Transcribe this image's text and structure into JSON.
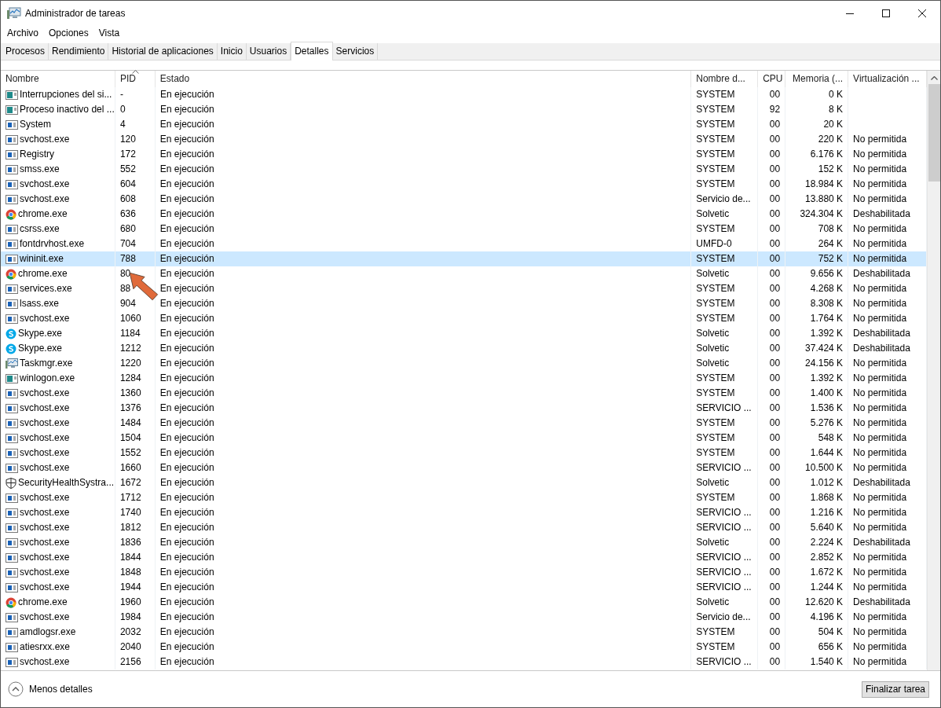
{
  "window": {
    "title": "Administrador de tareas"
  },
  "menu": [
    "Archivo",
    "Opciones",
    "Vista"
  ],
  "tabs": [
    {
      "label": "Procesos",
      "selected": false
    },
    {
      "label": "Rendimiento",
      "selected": false
    },
    {
      "label": "Historial de aplicaciones",
      "selected": false
    },
    {
      "label": "Inicio",
      "selected": false
    },
    {
      "label": "Usuarios",
      "selected": false
    },
    {
      "label": "Detalles",
      "selected": true
    },
    {
      "label": "Servicios",
      "selected": false
    }
  ],
  "table": {
    "columns": [
      {
        "label": "Nombre",
        "sorted": false
      },
      {
        "label": "PID",
        "sorted": true
      },
      {
        "label": "Estado",
        "sorted": false
      },
      {
        "label": "Nombre d...",
        "sorted": false
      },
      {
        "label": "CPU",
        "sorted": false
      },
      {
        "label": "Memoria (...",
        "sorted": false
      },
      {
        "label": "Virtualización ...",
        "sorted": false
      }
    ],
    "rows": [
      {
        "kind": "app",
        "name": "Interrupciones del si...",
        "pid": "-",
        "status": "En ejecución",
        "user": "SYSTEM",
        "cpu": "00",
        "memory": "0 K",
        "selected": false
      },
      {
        "kind": "app",
        "name": "Proceso inactivo del ...",
        "pid": "0",
        "status": "En ejecución",
        "user": "SYSTEM",
        "cpu": "92",
        "memory": "8 K",
        "selected": false
      },
      {
        "kind": "service",
        "name": "System",
        "pid": "4",
        "status": "En ejecución",
        "user": "SYSTEM",
        "cpu": "00",
        "memory": "20 K",
        "selected": false
      },
      {
        "kind": "service",
        "name": "svchost.exe",
        "pid": "120",
        "status": "En ejecución",
        "user": "SYSTEM",
        "cpu": "00",
        "memory": "220 K",
        "virtualization": "No permitida",
        "selected": false
      },
      {
        "kind": "service",
        "name": "Registry",
        "pid": "172",
        "status": "En ejecución",
        "user": "SYSTEM",
        "cpu": "00",
        "memory": "6.176 K",
        "virtualization": "No permitida",
        "selected": false
      },
      {
        "kind": "service",
        "name": "smss.exe",
        "pid": "552",
        "status": "En ejecución",
        "user": "SYSTEM",
        "cpu": "00",
        "memory": "152 K",
        "virtualization": "No permitida",
        "selected": false
      },
      {
        "kind": "service",
        "name": "svchost.exe",
        "pid": "604",
        "status": "En ejecución",
        "user": "SYSTEM",
        "cpu": "00",
        "memory": "18.984 K",
        "virtualization": "No permitida",
        "selected": false
      },
      {
        "kind": "service",
        "name": "svchost.exe",
        "pid": "608",
        "status": "En ejecución",
        "user": "Servicio de...",
        "cpu": "00",
        "memory": "13.880 K",
        "virtualization": "No permitida",
        "selected": false
      },
      {
        "kind": "chrome",
        "name": "chrome.exe",
        "pid": "636",
        "status": "En ejecución",
        "user": "Solvetic",
        "cpu": "00",
        "memory": "324.304 K",
        "virtualization": "Deshabilitada",
        "selected": false
      },
      {
        "kind": "service",
        "name": "csrss.exe",
        "pid": "680",
        "status": "En ejecución",
        "user": "SYSTEM",
        "cpu": "00",
        "memory": "708 K",
        "virtualization": "No permitida",
        "selected": false
      },
      {
        "kind": "service",
        "name": "fontdrvhost.exe",
        "pid": "704",
        "status": "En ejecución",
        "user": "UMFD-0",
        "cpu": "00",
        "memory": "264 K",
        "virtualization": "No permitida",
        "selected": false
      },
      {
        "kind": "service",
        "name": "wininit.exe",
        "pid": "788",
        "status": "En ejecución",
        "user": "SYSTEM",
        "cpu": "00",
        "memory": "752 K",
        "virtualization": "No permitida",
        "selected": true
      },
      {
        "kind": "chrome",
        "name": "chrome.exe",
        "pid": "80",
        "status": "En ejecución",
        "user": "Solvetic",
        "cpu": "00",
        "memory": "9.656 K",
        "virtualization": "Deshabilitada",
        "selected": false
      },
      {
        "kind": "service",
        "name": "services.exe",
        "pid": "88",
        "status": "En ejecución",
        "user": "SYSTEM",
        "cpu": "00",
        "memory": "4.268 K",
        "virtualization": "No permitida",
        "selected": false
      },
      {
        "kind": "service",
        "name": "lsass.exe",
        "pid": "904",
        "status": "En ejecución",
        "user": "SYSTEM",
        "cpu": "00",
        "memory": "8.308 K",
        "virtualization": "No permitida",
        "selected": false
      },
      {
        "kind": "service",
        "name": "svchost.exe",
        "pid": "1060",
        "status": "En ejecución",
        "user": "SYSTEM",
        "cpu": "00",
        "memory": "1.764 K",
        "virtualization": "No permitida",
        "selected": false
      },
      {
        "kind": "skype",
        "name": "Skype.exe",
        "pid": "1184",
        "status": "En ejecución",
        "user": "Solvetic",
        "cpu": "00",
        "memory": "1.392 K",
        "virtualization": "Deshabilitada",
        "selected": false
      },
      {
        "kind": "skype",
        "name": "Skype.exe",
        "pid": "1212",
        "status": "En ejecución",
        "user": "Solvetic",
        "cpu": "00",
        "memory": "37.424 K",
        "virtualization": "Deshabilitada",
        "selected": false
      },
      {
        "kind": "monitor",
        "name": "Taskmgr.exe",
        "pid": "1220",
        "status": "En ejecución",
        "user": "Solvetic",
        "cpu": "00",
        "memory": "24.156 K",
        "virtualization": "No permitida",
        "selected": false
      },
      {
        "kind": "app",
        "name": "winlogon.exe",
        "pid": "1284",
        "status": "En ejecución",
        "user": "SYSTEM",
        "cpu": "00",
        "memory": "1.392 K",
        "virtualization": "No permitida",
        "selected": false
      },
      {
        "kind": "service",
        "name": "svchost.exe",
        "pid": "1360",
        "status": "En ejecución",
        "user": "SYSTEM",
        "cpu": "00",
        "memory": "1.400 K",
        "virtualization": "No permitida",
        "selected": false
      },
      {
        "kind": "service",
        "name": "svchost.exe",
        "pid": "1376",
        "status": "En ejecución",
        "user": "SERVICIO ...",
        "cpu": "00",
        "memory": "1.536 K",
        "virtualization": "No permitida",
        "selected": false
      },
      {
        "kind": "service",
        "name": "svchost.exe",
        "pid": "1484",
        "status": "En ejecución",
        "user": "SYSTEM",
        "cpu": "00",
        "memory": "5.276 K",
        "virtualization": "No permitida",
        "selected": false
      },
      {
        "kind": "service",
        "name": "svchost.exe",
        "pid": "1504",
        "status": "En ejecución",
        "user": "SYSTEM",
        "cpu": "00",
        "memory": "548 K",
        "virtualization": "No permitida",
        "selected": false
      },
      {
        "kind": "service",
        "name": "svchost.exe",
        "pid": "1552",
        "status": "En ejecución",
        "user": "SYSTEM",
        "cpu": "00",
        "memory": "1.644 K",
        "virtualization": "No permitida",
        "selected": false
      },
      {
        "kind": "service",
        "name": "svchost.exe",
        "pid": "1660",
        "status": "En ejecución",
        "user": "SERVICIO ...",
        "cpu": "00",
        "memory": "10.500 K",
        "virtualization": "No permitida",
        "selected": false
      },
      {
        "kind": "shield",
        "name": "SecurityHealthSystra...",
        "pid": "1672",
        "status": "En ejecución",
        "user": "Solvetic",
        "cpu": "00",
        "memory": "1.012 K",
        "virtualization": "Deshabilitada",
        "selected": false
      },
      {
        "kind": "service",
        "name": "svchost.exe",
        "pid": "1712",
        "status": "En ejecución",
        "user": "SYSTEM",
        "cpu": "00",
        "memory": "1.868 K",
        "virtualization": "No permitida",
        "selected": false
      },
      {
        "kind": "service",
        "name": "svchost.exe",
        "pid": "1740",
        "status": "En ejecución",
        "user": "SERVICIO ...",
        "cpu": "00",
        "memory": "1.216 K",
        "virtualization": "No permitida",
        "selected": false
      },
      {
        "kind": "service",
        "name": "svchost.exe",
        "pid": "1812",
        "status": "En ejecución",
        "user": "SERVICIO ...",
        "cpu": "00",
        "memory": "5.640 K",
        "virtualization": "No permitida",
        "selected": false
      },
      {
        "kind": "service",
        "name": "svchost.exe",
        "pid": "1836",
        "status": "En ejecución",
        "user": "Solvetic",
        "cpu": "00",
        "memory": "2.224 K",
        "virtualization": "Deshabilitada",
        "selected": false
      },
      {
        "kind": "service",
        "name": "svchost.exe",
        "pid": "1844",
        "status": "En ejecución",
        "user": "SERVICIO ...",
        "cpu": "00",
        "memory": "2.852 K",
        "virtualization": "No permitida",
        "selected": false
      },
      {
        "kind": "service",
        "name": "svchost.exe",
        "pid": "1848",
        "status": "En ejecución",
        "user": "SERVICIO ...",
        "cpu": "00",
        "memory": "1.672 K",
        "virtualization": "No permitida",
        "selected": false
      },
      {
        "kind": "service",
        "name": "svchost.exe",
        "pid": "1944",
        "status": "En ejecución",
        "user": "SERVICIO ...",
        "cpu": "00",
        "memory": "1.244 K",
        "virtualization": "No permitida",
        "selected": false
      },
      {
        "kind": "chrome",
        "name": "chrome.exe",
        "pid": "1960",
        "status": "En ejecución",
        "user": "Solvetic",
        "cpu": "00",
        "memory": "12.620 K",
        "virtualization": "Deshabilitada",
        "selected": false
      },
      {
        "kind": "service",
        "name": "svchost.exe",
        "pid": "1984",
        "status": "En ejecución",
        "user": "Servicio de...",
        "cpu": "00",
        "memory": "4.196 K",
        "virtualization": "No permitida",
        "selected": false
      },
      {
        "kind": "service",
        "name": "amdlogsr.exe",
        "pid": "2032",
        "status": "En ejecución",
        "user": "SYSTEM",
        "cpu": "00",
        "memory": "504 K",
        "virtualization": "No permitida",
        "selected": false
      },
      {
        "kind": "service",
        "name": "atiesrxx.exe",
        "pid": "2040",
        "status": "En ejecución",
        "user": "SYSTEM",
        "cpu": "00",
        "memory": "656 K",
        "virtualization": "No permitida",
        "selected": false
      },
      {
        "kind": "service",
        "name": "svchost.exe",
        "pid": "2156",
        "status": "En ejecución",
        "user": "SERVICIO ...",
        "cpu": "00",
        "memory": "1.540 K",
        "virtualization": "No permitida",
        "selected": false
      }
    ]
  },
  "footer": {
    "link": "Menos detalles",
    "button": "Finalizar tarea"
  }
}
